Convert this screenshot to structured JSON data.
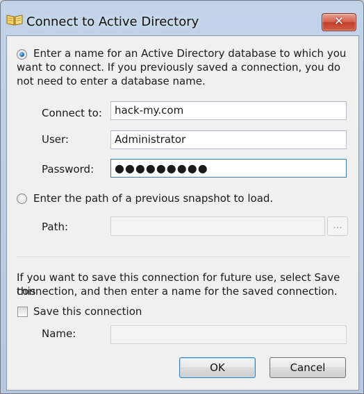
{
  "window": {
    "title": "Connect to Active Directory",
    "close_label": "✕",
    "icon": "open-book-icon"
  },
  "connect_option": {
    "selected": true,
    "text_line1": "Enter a name for an Active Directory database to which you",
    "text_line2": "want to connect. If you previously saved a connection, you do",
    "text_line3": "not need to enter a database name."
  },
  "fields": {
    "connect_to_label": "Connect to:",
    "connect_to_value": "hack-my.com",
    "user_label": "User:",
    "user_value": "Administrator",
    "password_label": "Password:",
    "password_value": "●●●●●●●●●"
  },
  "snapshot_option": {
    "selected": false,
    "text": "Enter the path of a previous snapshot to load.",
    "path_label": "Path:",
    "path_value": "",
    "browse_label": "..."
  },
  "save_section": {
    "info_line1": "If you want to save this connection for future use, select Save this",
    "info_line2": "connection, and then enter a name for the saved connection.",
    "checkbox_label": "Save this connection",
    "checked": false,
    "name_label": "Name:",
    "name_value": ""
  },
  "buttons": {
    "ok_label": "OK",
    "cancel_label": "Cancel"
  },
  "colors": {
    "title_bar": "#bccfe6",
    "close_button": "#c9422e",
    "default_button_border": "#3c7fb1",
    "focused_field_border": "#3d7bad"
  }
}
